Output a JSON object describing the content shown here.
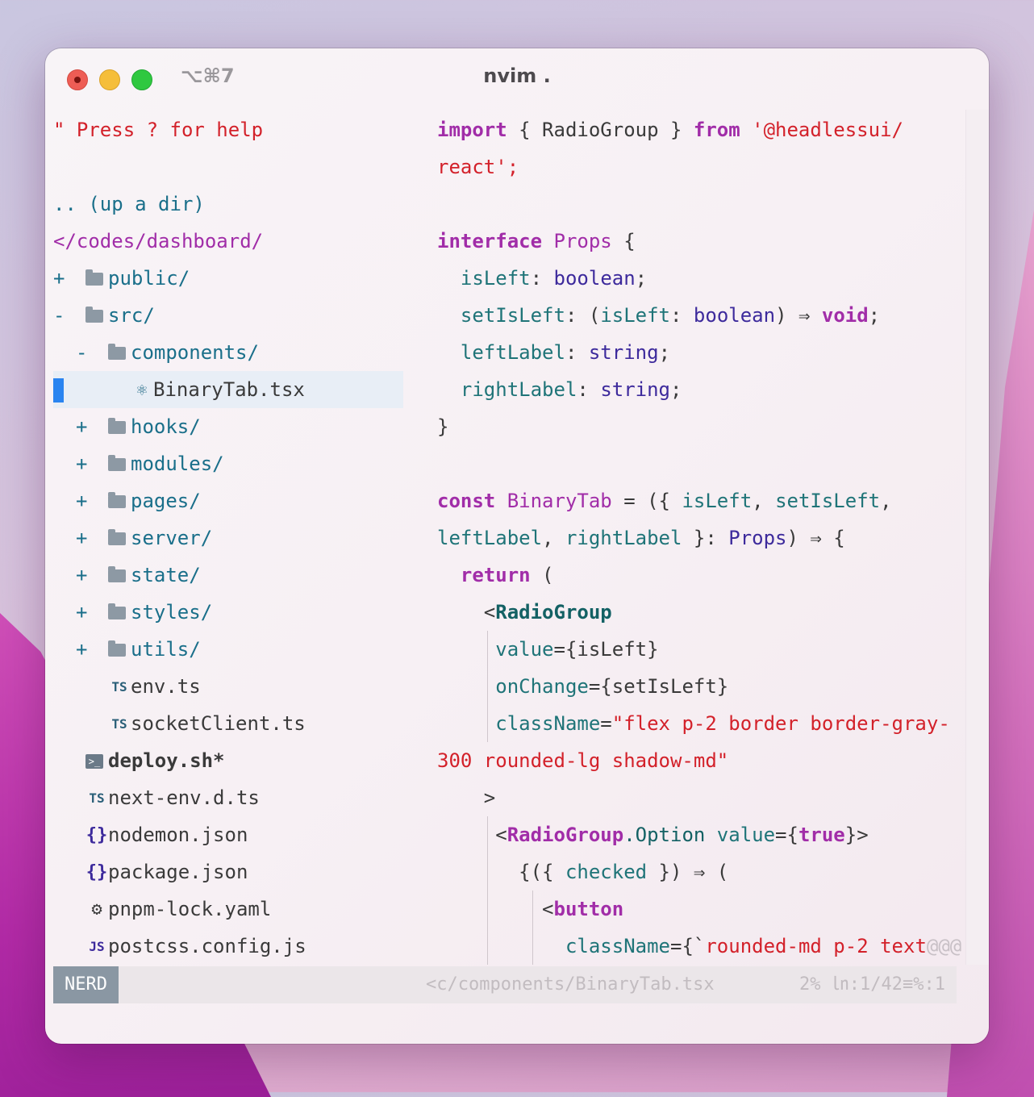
{
  "window": {
    "shortcut": "⌥⌘7",
    "title": "nvim ."
  },
  "tree": {
    "help": "\" Press ? for help",
    "updir": ".. (up a dir)",
    "cwd": "</codes/dashboard/",
    "items": [
      {
        "sign": "+",
        "name": "public/"
      },
      {
        "sign": "-",
        "name": "src/"
      },
      {
        "sign": "-",
        "name": "components/"
      },
      {
        "name": "BinaryTab.tsx"
      },
      {
        "sign": "+",
        "name": "hooks/"
      },
      {
        "sign": "+",
        "name": "modules/"
      },
      {
        "sign": "+",
        "name": "pages/"
      },
      {
        "sign": "+",
        "name": "server/"
      },
      {
        "sign": "+",
        "name": "state/"
      },
      {
        "sign": "+",
        "name": "styles/"
      },
      {
        "sign": "+",
        "name": "utils/"
      },
      {
        "icon": "TS",
        "name": "env.ts"
      },
      {
        "icon": "TS",
        "name": "socketClient.ts"
      },
      {
        "name": "deploy.sh*"
      },
      {
        "icon": "TS",
        "name": "next-env.d.ts"
      },
      {
        "icon": "{}",
        "name": "nodemon.json"
      },
      {
        "icon": "{}",
        "name": "package.json"
      },
      {
        "icon": "⚙",
        "name": "pnpm-lock.yaml"
      },
      {
        "icon": "JS",
        "name": "postcss.config.js"
      }
    ]
  },
  "code": {
    "l1": [
      "import",
      " { RadioGroup } ",
      "from",
      " '@headlessui/"
    ],
    "l2": "react';",
    "l4": [
      "interface",
      " ",
      "Props",
      " {"
    ],
    "l5": [
      "isLeft",
      ": ",
      "boolean",
      ";"
    ],
    "l6": [
      "setIsLeft",
      ": (",
      "isLeft",
      ": ",
      "boolean",
      ") ⇒ ",
      "void",
      ";"
    ],
    "l7": [
      "leftLabel",
      ": ",
      "string",
      ";"
    ],
    "l8": [
      "rightLabel",
      ": ",
      "string",
      ";"
    ],
    "l9": "}",
    "l11": [
      "const",
      " ",
      "BinaryTab",
      " = ({ ",
      "isLeft",
      ", ",
      "setIsLeft",
      ","
    ],
    "l12": [
      "leftLabel",
      ", ",
      "rightLabel",
      " }: ",
      "Props",
      ") ⇒ {"
    ],
    "l13": [
      "return",
      " ("
    ],
    "l14": [
      "<",
      "RadioGroup"
    ],
    "l15": [
      "value",
      "={",
      "isLeft",
      "}"
    ],
    "l16": [
      "onChange",
      "={",
      "setIsLeft",
      "}"
    ],
    "l17": [
      "className",
      "=",
      "\"flex p-2 border border-gray-"
    ],
    "l18": "300 rounded-lg shadow-md\"",
    "l19": ">",
    "l20": [
      "<",
      "RadioGroup",
      ".Option ",
      "value",
      "={",
      "true",
      "}>"
    ],
    "l21": [
      "{({ ",
      "checked",
      " }) ⇒ ("
    ],
    "l22": [
      "<",
      "button"
    ],
    "l23": [
      "className",
      "={`",
      "rounded-md p-2 text",
      "@@@"
    ]
  },
  "status": {
    "mode": "NERD",
    "file": "<c/components/BinaryTab.tsx",
    "position": "2%  ㏑:1/42≡%:1"
  }
}
